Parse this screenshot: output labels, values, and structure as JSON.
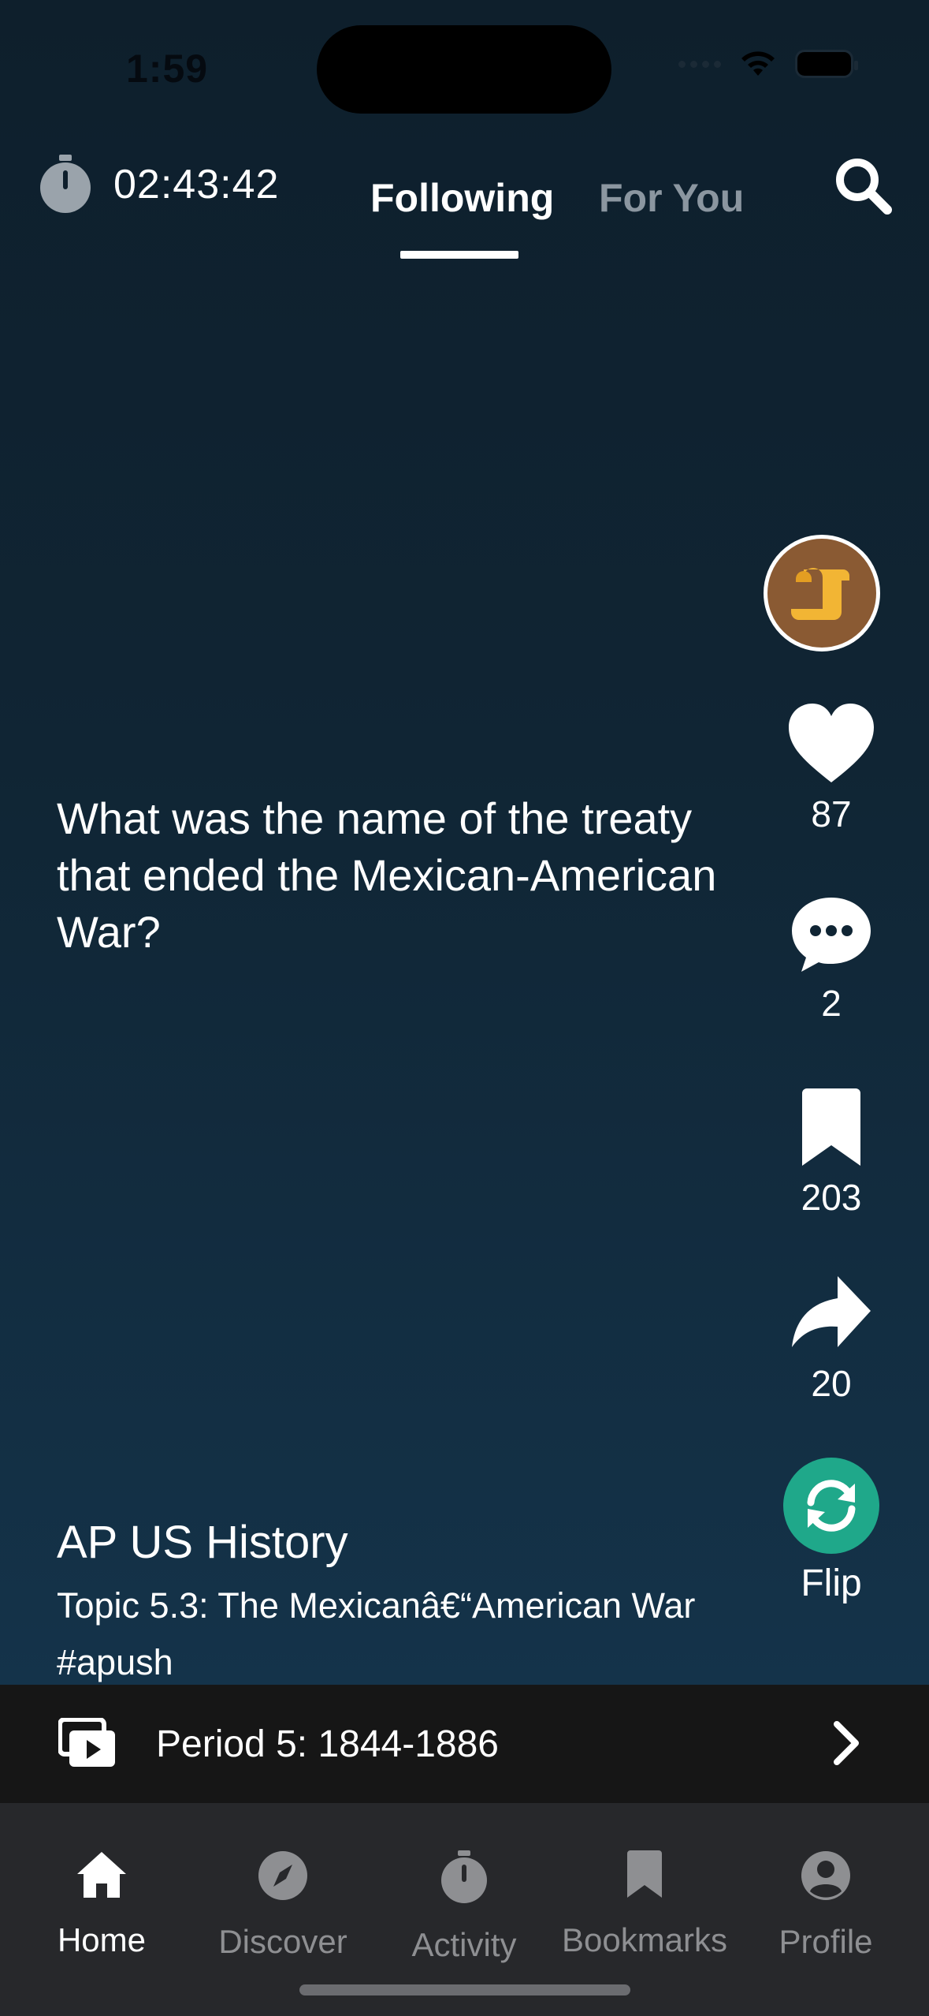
{
  "status_bar": {
    "time": "1:59"
  },
  "header": {
    "timer": "02:43:42",
    "tabs": [
      {
        "label": "Following",
        "active": true
      },
      {
        "label": "For You",
        "active": false
      }
    ]
  },
  "card": {
    "question": "What was the name of the treaty that ended the Mexican-American War?",
    "course": "AP US History",
    "description": "Topic 5.3: The Mexicanâ€“American War #apush"
  },
  "actions": {
    "likes": "87",
    "comments": "2",
    "bookmarks": "203",
    "shares": "20",
    "flip_label": "Flip"
  },
  "playlist": {
    "label": "Period 5: 1844-1886"
  },
  "nav": [
    {
      "label": "Home",
      "icon": "home-icon",
      "active": true
    },
    {
      "label": "Discover",
      "icon": "compass-icon",
      "active": false
    },
    {
      "label": "Activity",
      "icon": "stopwatch-icon",
      "active": false
    },
    {
      "label": "Bookmarks",
      "icon": "bookmark-icon",
      "active": false
    },
    {
      "label": "Profile",
      "icon": "profile-icon",
      "active": false
    }
  ],
  "colors": {
    "background": "#0e1f2c",
    "flip_accent": "#1fa88a",
    "avatar_bg": "#8a5a33",
    "inactive_gray": "#8e8f92"
  }
}
